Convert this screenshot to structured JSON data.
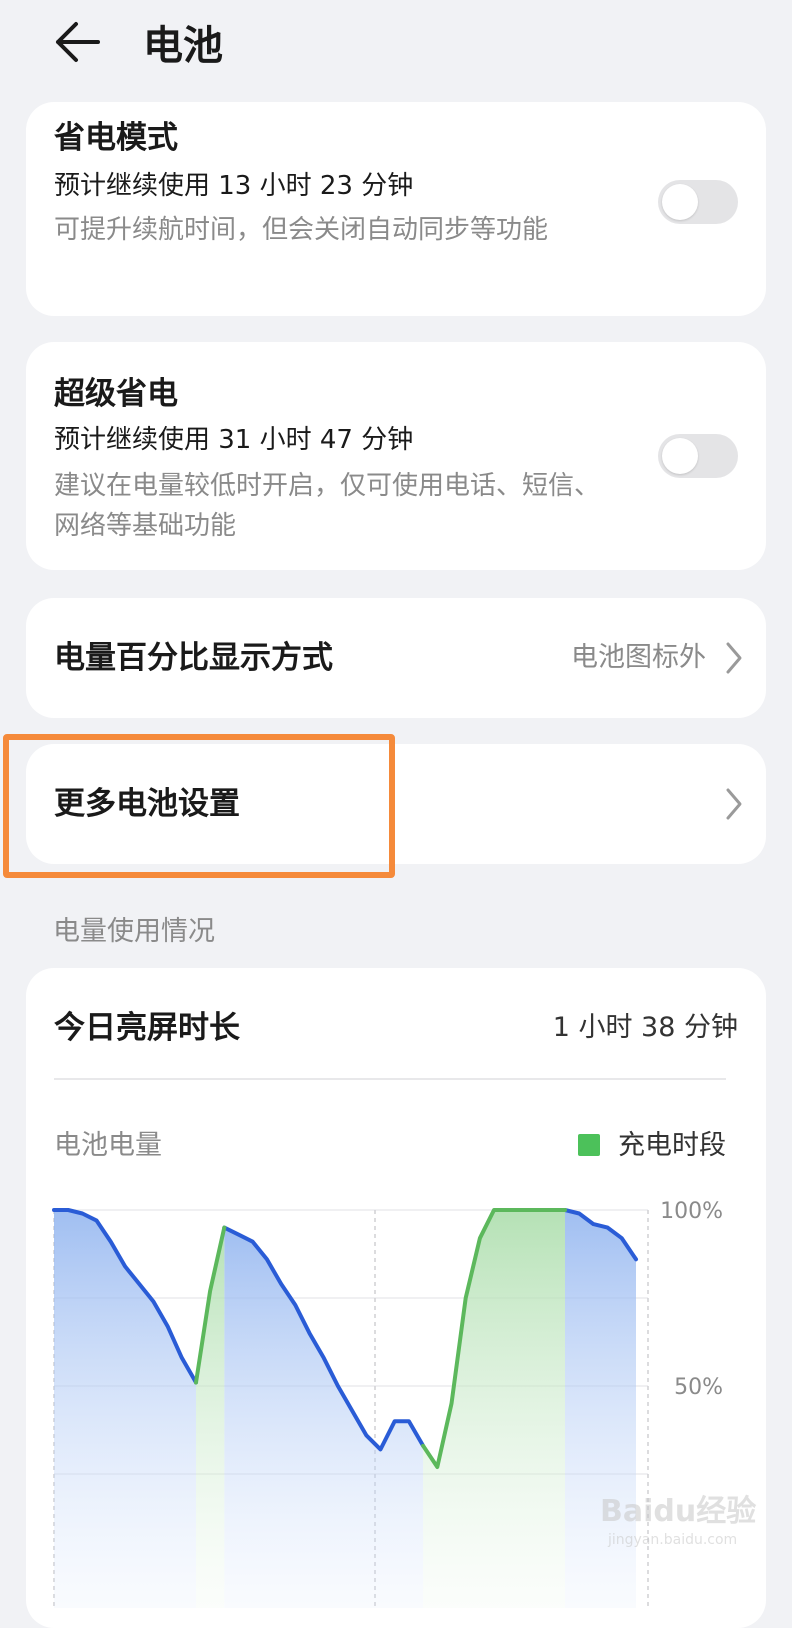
{
  "header": {
    "title": "电池"
  },
  "power_saving": {
    "title": "省电模式",
    "estimate": "预计继续使用 13 小时 23 分钟",
    "description": "可提升续航时间，但会关闭自动同步等功能",
    "enabled": false
  },
  "ultra_saving": {
    "title": "超级省电",
    "estimate": "预计继续使用 31 小时 47 分钟",
    "description": "建议在电量较低时开启，仅可使用电话、短信、网络等基础功能",
    "enabled": false
  },
  "percent_display": {
    "title": "电量百分比显示方式",
    "value": "电池图标外"
  },
  "more_settings": {
    "title": "更多电池设置"
  },
  "usage": {
    "section_label": "电量使用情况",
    "screen_time_title": "今日亮屏时长",
    "screen_time_value": "1 小时 38 分钟",
    "battery_label": "电池电量",
    "legend_label": "充电时段"
  },
  "colors": {
    "accent_highlight": "#f58a3a",
    "discharge_line": "#2a5cd6",
    "charge_line": "#5cb85c",
    "legend_swatch": "#4cc15a"
  },
  "watermark": {
    "text": "Baidu经验",
    "sub": "jingyan.baidu.com"
  },
  "chart_data": {
    "type": "area",
    "ylabel": "",
    "yticks": [
      "100%",
      "50%"
    ],
    "ylim": [
      0,
      100
    ],
    "x": [
      0,
      1,
      2,
      3,
      4,
      5,
      6,
      7,
      8,
      9,
      10,
      11,
      12,
      13,
      14,
      15,
      16,
      17,
      18,
      19,
      20,
      21,
      22,
      23,
      24,
      25,
      26,
      27,
      28,
      29,
      30,
      31,
      32,
      33,
      34,
      35,
      36,
      37,
      38,
      39,
      40,
      41
    ],
    "y": [
      100,
      100,
      99,
      97,
      91,
      84,
      79,
      74,
      67,
      58,
      51,
      77,
      95,
      93,
      91,
      86,
      79,
      73,
      65,
      58,
      50,
      43,
      36,
      32,
      40,
      40,
      33,
      27,
      45,
      75,
      92,
      100,
      100,
      100,
      100,
      100,
      100,
      99,
      96,
      95,
      92,
      86
    ],
    "series": [
      {
        "name": "",
        "segments": [
          [
            0,
            10
          ],
          [
            12,
            26
          ],
          [
            36,
            41
          ]
        ]
      },
      {
        "name": "充电时段",
        "segments": [
          [
            10,
            12
          ],
          [
            26,
            36
          ]
        ]
      }
    ]
  }
}
